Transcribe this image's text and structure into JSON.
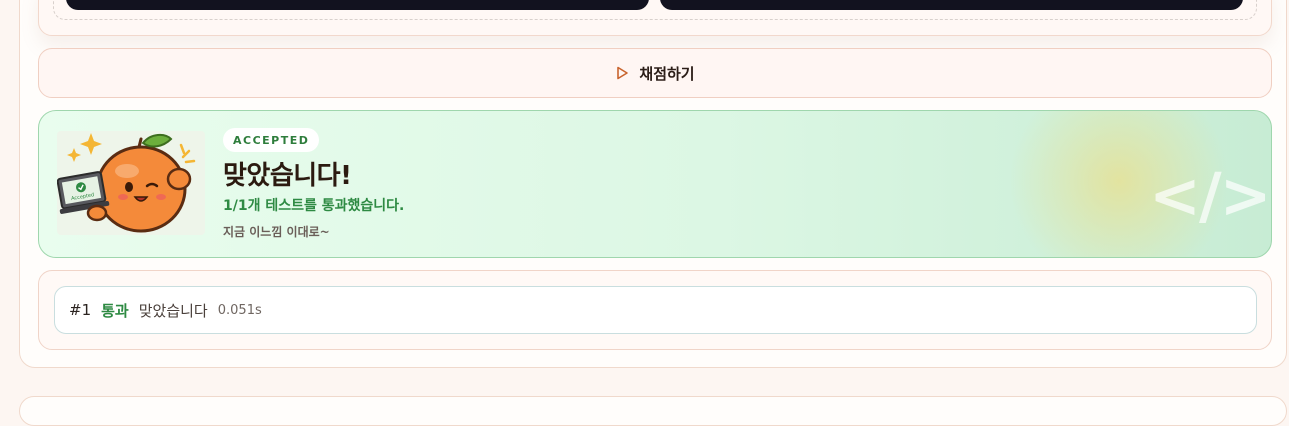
{
  "grade": {
    "label": "채점하기"
  },
  "result": {
    "badge": "ACCEPTED",
    "title": "맞았습니다!",
    "summary": "1/1개 테스트를 통과했습니다.",
    "comment": "지금 이느낌 이대로~",
    "watermark": "</>",
    "mascot_screen_text": "Accepted",
    "colors": {
      "accent": "#2e8a43",
      "card_border": "#9fd6ad"
    }
  },
  "tests": [
    {
      "num": "#1",
      "status": "통과",
      "message": "맞았습니다",
      "time": "0.051s"
    }
  ]
}
